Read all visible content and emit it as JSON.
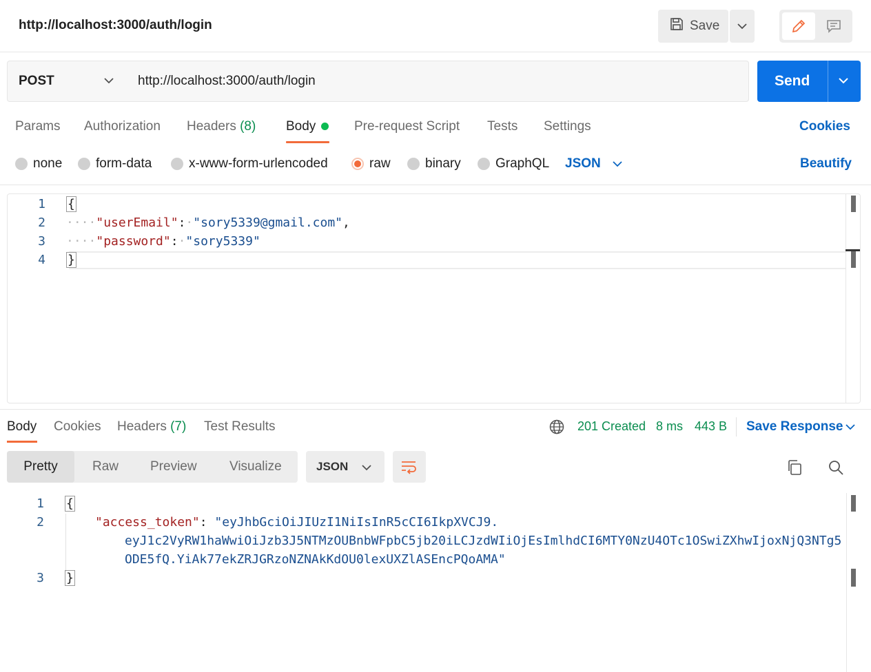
{
  "header": {
    "title": "http://localhost:3000/auth/login",
    "save_label": "Save"
  },
  "request": {
    "method": "POST",
    "url": "http://localhost:3000/auth/login",
    "send_label": "Send",
    "tabs": [
      {
        "label": "Params"
      },
      {
        "label": "Authorization"
      },
      {
        "label": "Headers",
        "count": "(8)"
      },
      {
        "label": "Body"
      },
      {
        "label": "Pre-request Script"
      },
      {
        "label": "Tests"
      },
      {
        "label": "Settings"
      }
    ],
    "active_tab": "Body",
    "cookies_label": "Cookies",
    "body_types": [
      "none",
      "form-data",
      "x-www-form-urlencoded",
      "raw",
      "binary",
      "GraphQL"
    ],
    "selected_body_type": "raw",
    "format": "JSON",
    "beautify_label": "Beautify",
    "code": {
      "line_numbers": [
        "1",
        "2",
        "3",
        "4"
      ],
      "open": "{",
      "close": "}",
      "email_key": "\"userEmail\"",
      "email_value": "\"sory5339@gmail.com\"",
      "password_key": "\"password\"",
      "password_value": "\"sory5339\""
    }
  },
  "response": {
    "tabs": [
      {
        "label": "Body"
      },
      {
        "label": "Cookies"
      },
      {
        "label": "Headers",
        "count": "(7)"
      },
      {
        "label": "Test Results"
      }
    ],
    "active_tab": "Body",
    "status": "201 Created",
    "time": "8 ms",
    "size": "443 B",
    "save_response_label": "Save Response",
    "views": [
      "Pretty",
      "Raw",
      "Preview",
      "Visualize"
    ],
    "active_view": "Pretty",
    "format": "JSON",
    "code": {
      "line_numbers": [
        "1",
        "2",
        "3"
      ],
      "open": "{",
      "close": "}",
      "token_key": "\"access_token\"",
      "token_line1": "\"eyJhbGciOiJIUzI1NiIsInR5cCI6IkpXVCJ9.",
      "token_line2": "eyJ1c2VyRW1haWwiOiJzb3J5NTMzOUBnbWFpbC5jb20iLCJzdWIiOjEsImlhdCI6MTY0NzU4OTc1OSwiZXhwIjoxNjQ3NTg5",
      "token_line3": "ODE5fQ.YiAk77ekZRJGRzoNZNAkKdOU0lexUXZlASEncPQoAMA\""
    }
  },
  "colors": {
    "accent": "#f26b3a",
    "primary_button": "#0c72e5",
    "link": "#0a65c2",
    "success": "#0a8d4f"
  }
}
